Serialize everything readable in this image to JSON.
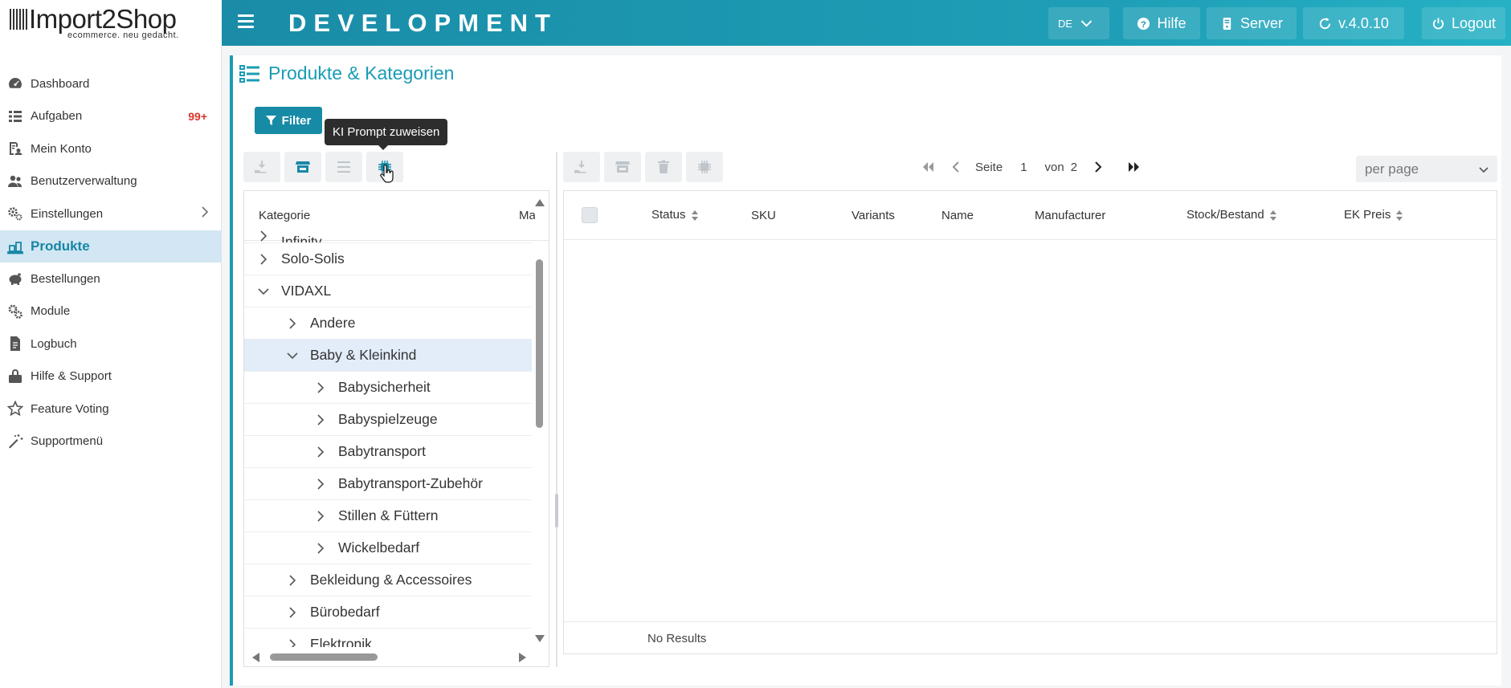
{
  "logo": {
    "text": "Import2Shop",
    "tagline": "ecommerce. neu gedacht."
  },
  "topbar": {
    "title": "DEVELOPMENT",
    "language": "DE",
    "help_label": "Hilfe",
    "server_label": "Server",
    "version_label": "v.4.0.10",
    "logout_label": "Logout"
  },
  "sidebar": {
    "items": [
      {
        "label": "Dashboard",
        "icon": "dashboard-icon"
      },
      {
        "label": "Aufgaben",
        "icon": "tasks-icon",
        "badge": "99+"
      },
      {
        "label": "Mein Konto",
        "icon": "account-icon"
      },
      {
        "label": "Benutzerverwaltung",
        "icon": "users-icon"
      },
      {
        "label": "Einstellungen",
        "icon": "settings-icon"
      },
      {
        "label": "Produkte",
        "icon": "products-icon",
        "active": true
      },
      {
        "label": "Bestellungen",
        "icon": "orders-icon"
      },
      {
        "label": "Module",
        "icon": "modules-icon"
      },
      {
        "label": "Logbuch",
        "icon": "logbook-icon"
      },
      {
        "label": "Hilfe & Support",
        "icon": "support-icon"
      },
      {
        "label": "Feature Voting",
        "icon": "star-icon"
      },
      {
        "label": "Supportmenü",
        "icon": "magic-wand-icon"
      }
    ]
  },
  "page": {
    "title": "Produkte & Kategorien",
    "filter_label": "Filter",
    "tooltip": "KI Prompt zuweisen"
  },
  "tree": {
    "header_kategorie": "Kategorie",
    "header_ma": "Ma",
    "rows": [
      {
        "label": "Infinity",
        "level": 1,
        "expanded": false
      },
      {
        "label": "Solo-Solis",
        "level": 1,
        "expanded": false
      },
      {
        "label": "VIDAXL",
        "level": 1,
        "expanded": true
      },
      {
        "label": "Andere",
        "level": 2,
        "expanded": false
      },
      {
        "label": "Baby & Kleinkind",
        "level": 2,
        "expanded": true,
        "selected": true
      },
      {
        "label": "Babysicherheit",
        "level": 3,
        "expanded": false
      },
      {
        "label": "Babyspielzeuge",
        "level": 3,
        "expanded": false
      },
      {
        "label": "Babytransport",
        "level": 3,
        "expanded": false
      },
      {
        "label": "Babytransport-Zubehör",
        "level": 3,
        "expanded": false
      },
      {
        "label": "Stillen & Füttern",
        "level": 3,
        "expanded": false
      },
      {
        "label": "Wickelbedarf",
        "level": 3,
        "expanded": false
      },
      {
        "label": "Bekleidung & Accessoires",
        "level": 2,
        "expanded": false
      },
      {
        "label": "Bürobedarf",
        "level": 2,
        "expanded": false
      },
      {
        "label": "Elektronik",
        "level": 2,
        "expanded": false
      }
    ]
  },
  "pager": {
    "page_label": "Seite",
    "page_current": "1",
    "of_label": "von",
    "page_total": "2",
    "per_page_placeholder": "per page"
  },
  "grid": {
    "columns": {
      "status": "Status",
      "sku": "SKU",
      "variants": "Variants",
      "name": "Name",
      "manufacturer": "Manufacturer",
      "stock": "Stock/Bestand",
      "ek_preis": "EK Preis"
    },
    "no_results": "No Results"
  },
  "colors": {
    "accent": "#1a9cb5",
    "topbar_start": "#1a8ca7",
    "active_nav_bg": "#d2e6f4",
    "badge": "#d9342b",
    "tooltip_bg": "#2d2d2d"
  }
}
